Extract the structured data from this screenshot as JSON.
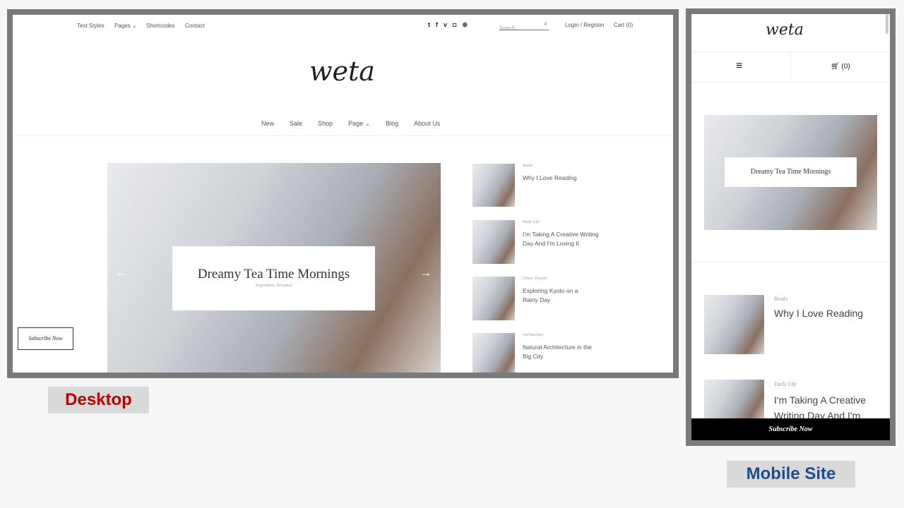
{
  "desktop": {
    "top_nav": [
      "Text Styles",
      "Pages",
      "Shortcodes",
      "Contact"
    ],
    "social_icons": [
      "twitter-icon",
      "facebook-icon",
      "vimeo-icon",
      "instagram-icon",
      "pinterest-icon"
    ],
    "search_placeholder": "Search...",
    "login": "Login / Register",
    "cart": "Cart (0)",
    "logo": "weta",
    "main_nav": [
      "New",
      "Sale",
      "Shop",
      "Page",
      "Blog",
      "About Us"
    ],
    "slider": {
      "title": "Dreamy Tea Time Mornings",
      "categories": "Inspiration, Personal"
    },
    "posts": [
      {
        "category": "Books",
        "title": "Why I Love Reading"
      },
      {
        "category": "Daily Life",
        "title": "I'm Taking A Creative Writing Day And I'm Loving It"
      },
      {
        "category": "Cities, Travels",
        "title": "Exploring Kyoto on a Rainy Day"
      },
      {
        "category": "Architecture",
        "title": "Natural Architecture in the Big City"
      }
    ],
    "subscribe": "Subscribe Now"
  },
  "mobile": {
    "logo": "weta",
    "cart_count": "(0)",
    "slider_title": "Dreamy Tea Time Mornings",
    "posts": [
      {
        "category": "Books",
        "title": "Why I Love Reading"
      },
      {
        "category": "Daily Life",
        "title": "I'm Taking A Creative Writing Day And I'm"
      }
    ],
    "subscribe": "Subscribe Now"
  },
  "labels": {
    "desktop": "Desktop",
    "mobile": "Mobile Site"
  },
  "colors": {
    "desktop_label": "#c00000",
    "mobile_label": "#1f4e8c",
    "frame": "#7a7a7a"
  }
}
